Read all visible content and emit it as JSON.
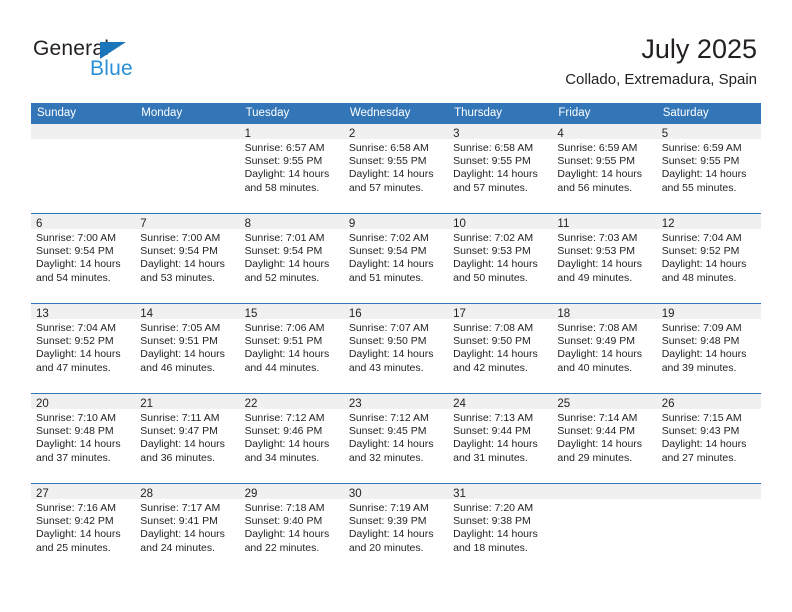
{
  "brand": {
    "name_line1": "General",
    "name_line2": "Blue",
    "accent_color": "#1b75bb",
    "accent_color_light": "#2a8fd4"
  },
  "header": {
    "month_title": "July 2025",
    "location": "Collado, Extremadura, Spain"
  },
  "theme": {
    "header_blue": "#3376b8",
    "band_gray": "#f0f0f0",
    "text_color": "#231f20"
  },
  "weekdays": [
    "Sunday",
    "Monday",
    "Tuesday",
    "Wednesday",
    "Thursday",
    "Friday",
    "Saturday"
  ],
  "weeks": [
    [
      {
        "day": "",
        "sunrise": "",
        "sunset": "",
        "daylight1": "",
        "daylight2": ""
      },
      {
        "day": "",
        "sunrise": "",
        "sunset": "",
        "daylight1": "",
        "daylight2": ""
      },
      {
        "day": "1",
        "sunrise": "Sunrise: 6:57 AM",
        "sunset": "Sunset: 9:55 PM",
        "daylight1": "Daylight: 14 hours",
        "daylight2": "and 58 minutes."
      },
      {
        "day": "2",
        "sunrise": "Sunrise: 6:58 AM",
        "sunset": "Sunset: 9:55 PM",
        "daylight1": "Daylight: 14 hours",
        "daylight2": "and 57 minutes."
      },
      {
        "day": "3",
        "sunrise": "Sunrise: 6:58 AM",
        "sunset": "Sunset: 9:55 PM",
        "daylight1": "Daylight: 14 hours",
        "daylight2": "and 57 minutes."
      },
      {
        "day": "4",
        "sunrise": "Sunrise: 6:59 AM",
        "sunset": "Sunset: 9:55 PM",
        "daylight1": "Daylight: 14 hours",
        "daylight2": "and 56 minutes."
      },
      {
        "day": "5",
        "sunrise": "Sunrise: 6:59 AM",
        "sunset": "Sunset: 9:55 PM",
        "daylight1": "Daylight: 14 hours",
        "daylight2": "and 55 minutes."
      }
    ],
    [
      {
        "day": "6",
        "sunrise": "Sunrise: 7:00 AM",
        "sunset": "Sunset: 9:54 PM",
        "daylight1": "Daylight: 14 hours",
        "daylight2": "and 54 minutes."
      },
      {
        "day": "7",
        "sunrise": "Sunrise: 7:00 AM",
        "sunset": "Sunset: 9:54 PM",
        "daylight1": "Daylight: 14 hours",
        "daylight2": "and 53 minutes."
      },
      {
        "day": "8",
        "sunrise": "Sunrise: 7:01 AM",
        "sunset": "Sunset: 9:54 PM",
        "daylight1": "Daylight: 14 hours",
        "daylight2": "and 52 minutes."
      },
      {
        "day": "9",
        "sunrise": "Sunrise: 7:02 AM",
        "sunset": "Sunset: 9:54 PM",
        "daylight1": "Daylight: 14 hours",
        "daylight2": "and 51 minutes."
      },
      {
        "day": "10",
        "sunrise": "Sunrise: 7:02 AM",
        "sunset": "Sunset: 9:53 PM",
        "daylight1": "Daylight: 14 hours",
        "daylight2": "and 50 minutes."
      },
      {
        "day": "11",
        "sunrise": "Sunrise: 7:03 AM",
        "sunset": "Sunset: 9:53 PM",
        "daylight1": "Daylight: 14 hours",
        "daylight2": "and 49 minutes."
      },
      {
        "day": "12",
        "sunrise": "Sunrise: 7:04 AM",
        "sunset": "Sunset: 9:52 PM",
        "daylight1": "Daylight: 14 hours",
        "daylight2": "and 48 minutes."
      }
    ],
    [
      {
        "day": "13",
        "sunrise": "Sunrise: 7:04 AM",
        "sunset": "Sunset: 9:52 PM",
        "daylight1": "Daylight: 14 hours",
        "daylight2": "and 47 minutes."
      },
      {
        "day": "14",
        "sunrise": "Sunrise: 7:05 AM",
        "sunset": "Sunset: 9:51 PM",
        "daylight1": "Daylight: 14 hours",
        "daylight2": "and 46 minutes."
      },
      {
        "day": "15",
        "sunrise": "Sunrise: 7:06 AM",
        "sunset": "Sunset: 9:51 PM",
        "daylight1": "Daylight: 14 hours",
        "daylight2": "and 44 minutes."
      },
      {
        "day": "16",
        "sunrise": "Sunrise: 7:07 AM",
        "sunset": "Sunset: 9:50 PM",
        "daylight1": "Daylight: 14 hours",
        "daylight2": "and 43 minutes."
      },
      {
        "day": "17",
        "sunrise": "Sunrise: 7:08 AM",
        "sunset": "Sunset: 9:50 PM",
        "daylight1": "Daylight: 14 hours",
        "daylight2": "and 42 minutes."
      },
      {
        "day": "18",
        "sunrise": "Sunrise: 7:08 AM",
        "sunset": "Sunset: 9:49 PM",
        "daylight1": "Daylight: 14 hours",
        "daylight2": "and 40 minutes."
      },
      {
        "day": "19",
        "sunrise": "Sunrise: 7:09 AM",
        "sunset": "Sunset: 9:48 PM",
        "daylight1": "Daylight: 14 hours",
        "daylight2": "and 39 minutes."
      }
    ],
    [
      {
        "day": "20",
        "sunrise": "Sunrise: 7:10 AM",
        "sunset": "Sunset: 9:48 PM",
        "daylight1": "Daylight: 14 hours",
        "daylight2": "and 37 minutes."
      },
      {
        "day": "21",
        "sunrise": "Sunrise: 7:11 AM",
        "sunset": "Sunset: 9:47 PM",
        "daylight1": "Daylight: 14 hours",
        "daylight2": "and 36 minutes."
      },
      {
        "day": "22",
        "sunrise": "Sunrise: 7:12 AM",
        "sunset": "Sunset: 9:46 PM",
        "daylight1": "Daylight: 14 hours",
        "daylight2": "and 34 minutes."
      },
      {
        "day": "23",
        "sunrise": "Sunrise: 7:12 AM",
        "sunset": "Sunset: 9:45 PM",
        "daylight1": "Daylight: 14 hours",
        "daylight2": "and 32 minutes."
      },
      {
        "day": "24",
        "sunrise": "Sunrise: 7:13 AM",
        "sunset": "Sunset: 9:44 PM",
        "daylight1": "Daylight: 14 hours",
        "daylight2": "and 31 minutes."
      },
      {
        "day": "25",
        "sunrise": "Sunrise: 7:14 AM",
        "sunset": "Sunset: 9:44 PM",
        "daylight1": "Daylight: 14 hours",
        "daylight2": "and 29 minutes."
      },
      {
        "day": "26",
        "sunrise": "Sunrise: 7:15 AM",
        "sunset": "Sunset: 9:43 PM",
        "daylight1": "Daylight: 14 hours",
        "daylight2": "and 27 minutes."
      }
    ],
    [
      {
        "day": "27",
        "sunrise": "Sunrise: 7:16 AM",
        "sunset": "Sunset: 9:42 PM",
        "daylight1": "Daylight: 14 hours",
        "daylight2": "and 25 minutes."
      },
      {
        "day": "28",
        "sunrise": "Sunrise: 7:17 AM",
        "sunset": "Sunset: 9:41 PM",
        "daylight1": "Daylight: 14 hours",
        "daylight2": "and 24 minutes."
      },
      {
        "day": "29",
        "sunrise": "Sunrise: 7:18 AM",
        "sunset": "Sunset: 9:40 PM",
        "daylight1": "Daylight: 14 hours",
        "daylight2": "and 22 minutes."
      },
      {
        "day": "30",
        "sunrise": "Sunrise: 7:19 AM",
        "sunset": "Sunset: 9:39 PM",
        "daylight1": "Daylight: 14 hours",
        "daylight2": "and 20 minutes."
      },
      {
        "day": "31",
        "sunrise": "Sunrise: 7:20 AM",
        "sunset": "Sunset: 9:38 PM",
        "daylight1": "Daylight: 14 hours",
        "daylight2": "and 18 minutes."
      },
      {
        "day": "",
        "sunrise": "",
        "sunset": "",
        "daylight1": "",
        "daylight2": ""
      },
      {
        "day": "",
        "sunrise": "",
        "sunset": "",
        "daylight1": "",
        "daylight2": ""
      }
    ]
  ]
}
